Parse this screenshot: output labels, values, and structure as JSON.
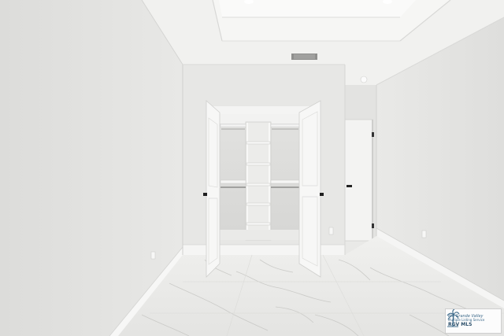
{
  "photo": {
    "subject": "empty-bedroom-with-open-walk-in-closet",
    "colors": {
      "wall": "#e6e6e4",
      "wall_shadow": "#d7d7d5",
      "ceiling": "#f1f1ef",
      "floor": "#ececea",
      "marble_vein": "#c9c9c6",
      "closet_interior": "#dcdcda",
      "trim": "#f6f6f5"
    }
  },
  "watermark": {
    "brand": "Rio Grande Valley",
    "subtitle": "Multiple Listing Service",
    "label": "RGV MLS"
  }
}
